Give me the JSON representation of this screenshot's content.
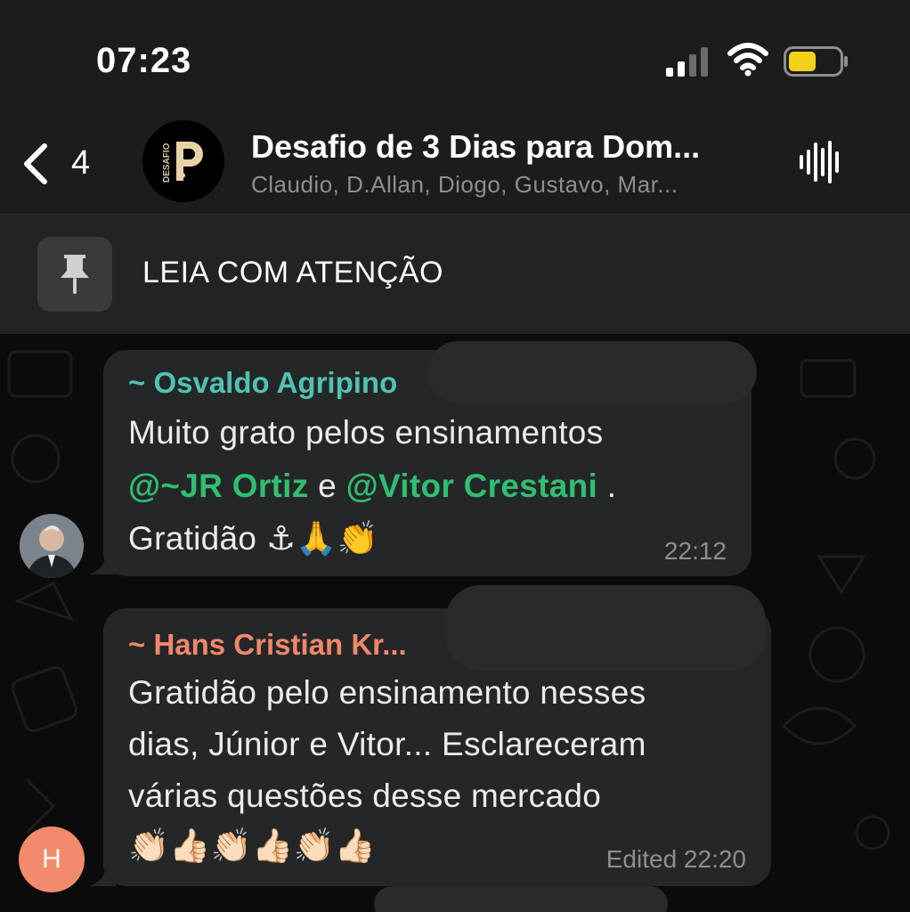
{
  "status_bar": {
    "time": "07:23",
    "battery_color": "#f4d21a"
  },
  "header": {
    "back_count": "4",
    "group_avatar_text": "DESAFIO",
    "title": "Desafio de 3 Dias para Dom...",
    "subtitle": "Claudio, D.Allan, Diogo, Gustavo, Mar..."
  },
  "pinned": {
    "text": "LEIA COM ATENÇÃO"
  },
  "messages": [
    {
      "sender": "~ Osvaldo Agripino",
      "sender_color": "#4fc3b3",
      "line1": "Muito grato pelos ensinamentos",
      "mention1": "@~JR Ortiz",
      "connector": " e ",
      "mention2": "@Vitor Crestani",
      "after_mentions": " .",
      "line3": "Gratidão ⚓🙏👏",
      "time": "22:12"
    },
    {
      "sender": "~ Hans Cristian Kr...",
      "sender_color": "#f0876a",
      "avatar_initial": "H",
      "line1": "Gratidão pelo ensinamento nesses",
      "line2": "dias, Júnior e Vitor... Esclareceram",
      "line3": "várias questões desse mercado",
      "line4": "👏🏻👍🏻👏🏻👍🏻👏🏻👍🏻",
      "time": "Edited 22:20"
    }
  ]
}
